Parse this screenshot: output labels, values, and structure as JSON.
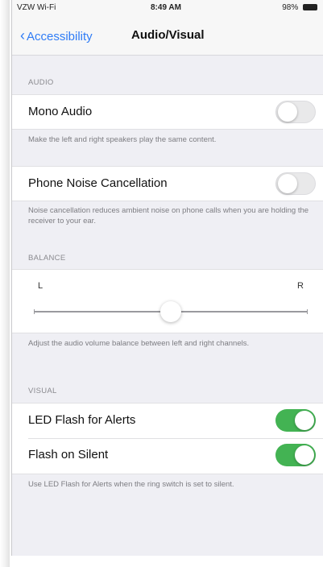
{
  "status_bar": {
    "carrier": "VZW Wi-Fi",
    "time": "8:49 AM",
    "battery": "98%"
  },
  "nav": {
    "back_label": "Accessibility",
    "title": "Audio/Visual"
  },
  "audio": {
    "header": "AUDIO",
    "mono_audio": {
      "label": "Mono Audio",
      "enabled": false,
      "footnote": "Make the left and right speakers play the same content."
    },
    "noise_cancellation": {
      "label": "Phone Noise Cancellation",
      "enabled": false,
      "footnote": "Noise cancellation reduces ambient noise on phone calls when you are holding the receiver to your ear."
    }
  },
  "balance": {
    "header": "BALANCE",
    "left_label": "L",
    "right_label": "R",
    "value": 0.5,
    "footnote": "Adjust the audio volume balance between left and right channels."
  },
  "visual": {
    "header": "VISUAL",
    "led_flash": {
      "label": "LED Flash for Alerts",
      "enabled": true
    },
    "flash_on_silent": {
      "label": "Flash on Silent",
      "enabled": true
    },
    "footnote": "Use LED Flash for Alerts when the ring switch is set to silent."
  },
  "colors": {
    "accent": "#2f7cf6",
    "toggle_on": "#43b353",
    "background": "#efeff4"
  }
}
